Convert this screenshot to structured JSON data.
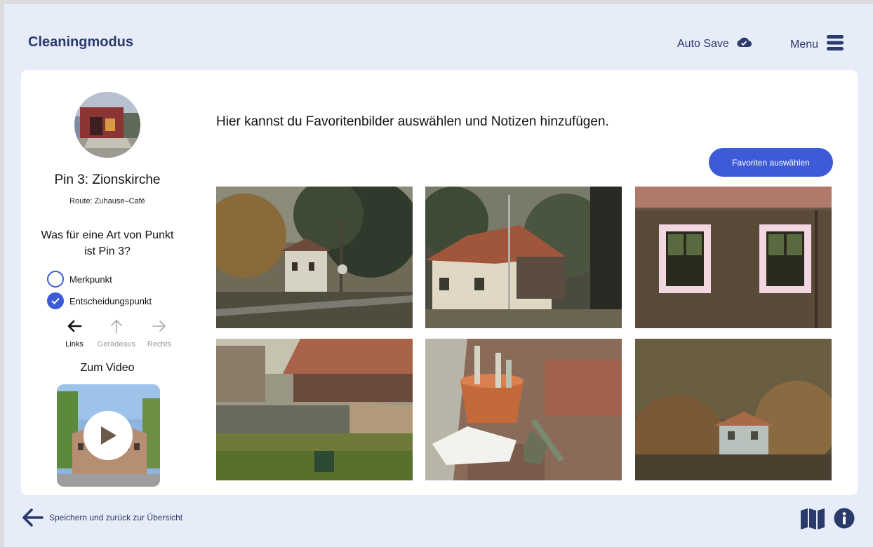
{
  "header": {
    "title": "Cleaningmodus",
    "autosave_label": "Auto Save",
    "menu_label": "Menu"
  },
  "sidebar": {
    "pin_title": "Pin 3: Zionskirche",
    "route": "Route: Zuhause–Café",
    "question": "Was für eine Art von Punkt ist Pin 3?",
    "options": [
      {
        "label": "Merkpunkt",
        "checked": false
      },
      {
        "label": "Entscheidungspunkt",
        "checked": true
      }
    ],
    "directions": [
      {
        "label": "Links",
        "active": true
      },
      {
        "label": "Geradeaus",
        "active": false
      },
      {
        "label": "Rechts",
        "active": false
      }
    ],
    "video_title": "Zum Video"
  },
  "main": {
    "instruction": "Hier kannst du Favoritenbilder auswählen und Notizen hinzufügen.",
    "favorites_button": "Favoriten auswählen"
  },
  "footer": {
    "back_label": "Speichern und zurück zur Übersicht"
  },
  "colors": {
    "accent": "#3d5bd9",
    "navy": "#2a3a6b",
    "background": "#e7ecf9"
  }
}
